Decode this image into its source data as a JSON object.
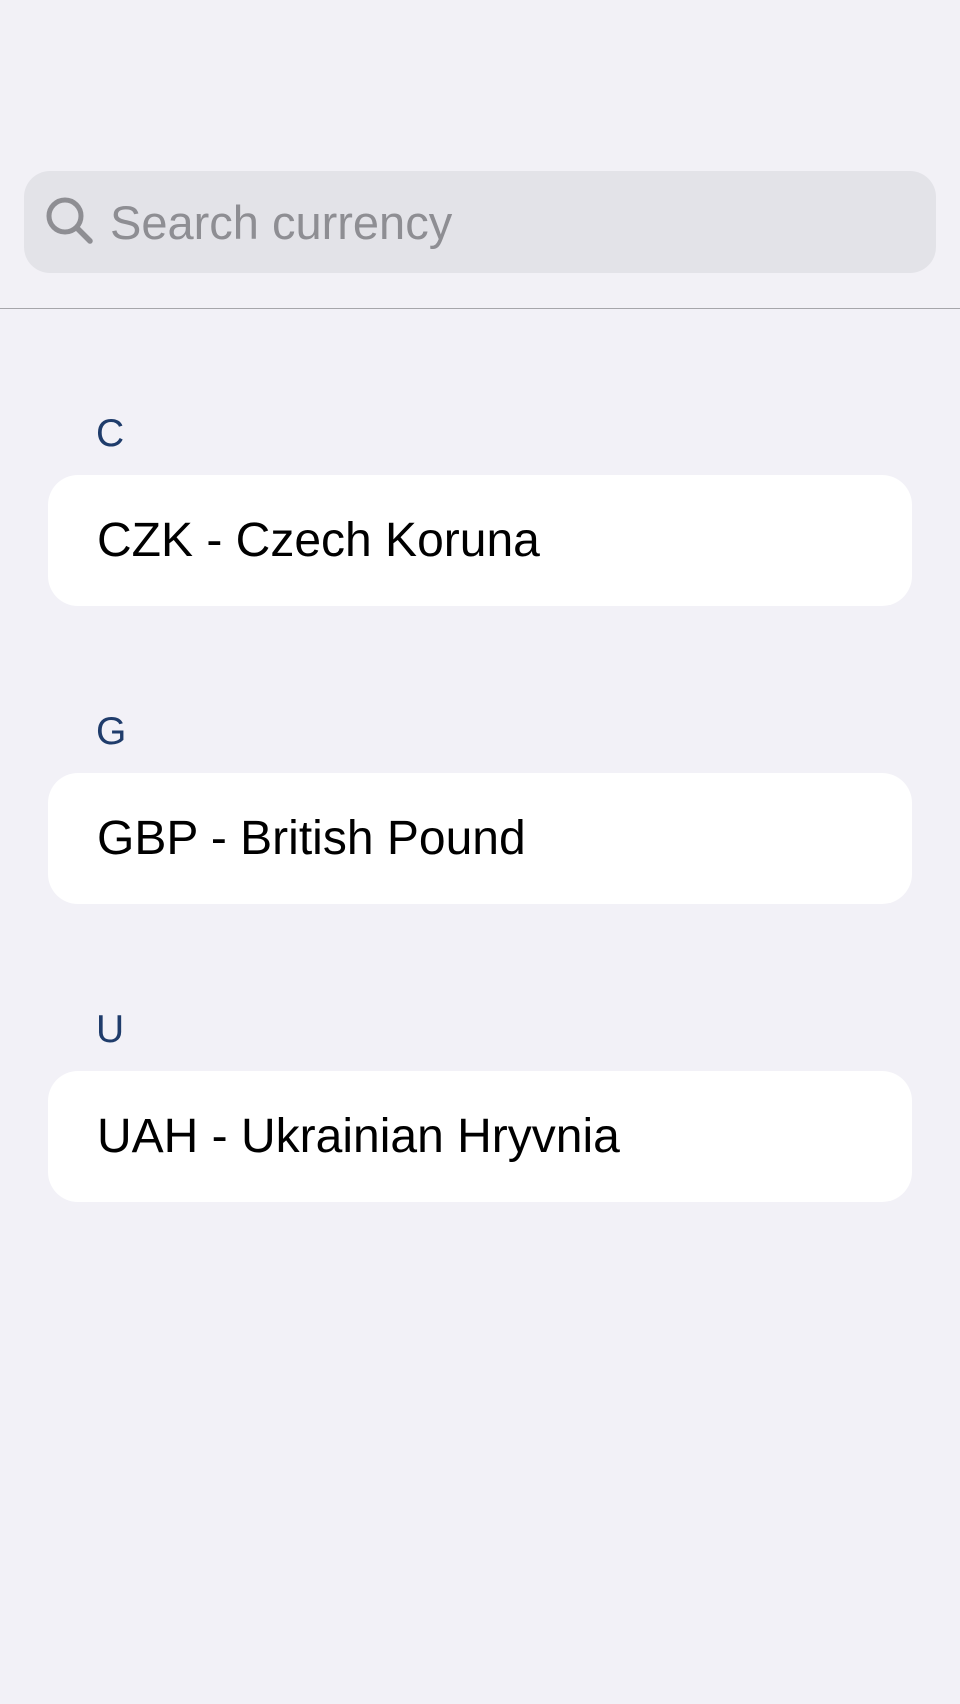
{
  "search": {
    "placeholder": "Search currency",
    "value": "",
    "icon": "search-icon"
  },
  "sections": [
    {
      "header": "C",
      "items": [
        {
          "label": "CZK - Czech Koruna"
        }
      ]
    },
    {
      "header": "G",
      "items": [
        {
          "label": "GBP - British Pound"
        }
      ]
    },
    {
      "header": "U",
      "items": [
        {
          "label": "UAH - Ukrainian Hryvnia"
        }
      ]
    }
  ],
  "colors": {
    "background": "#f2f1f7",
    "search_field": "#e3e3e8",
    "placeholder": "#8e8e93",
    "section_header": "#1f3c6b",
    "row_background": "#ffffff",
    "row_text": "#000000"
  }
}
